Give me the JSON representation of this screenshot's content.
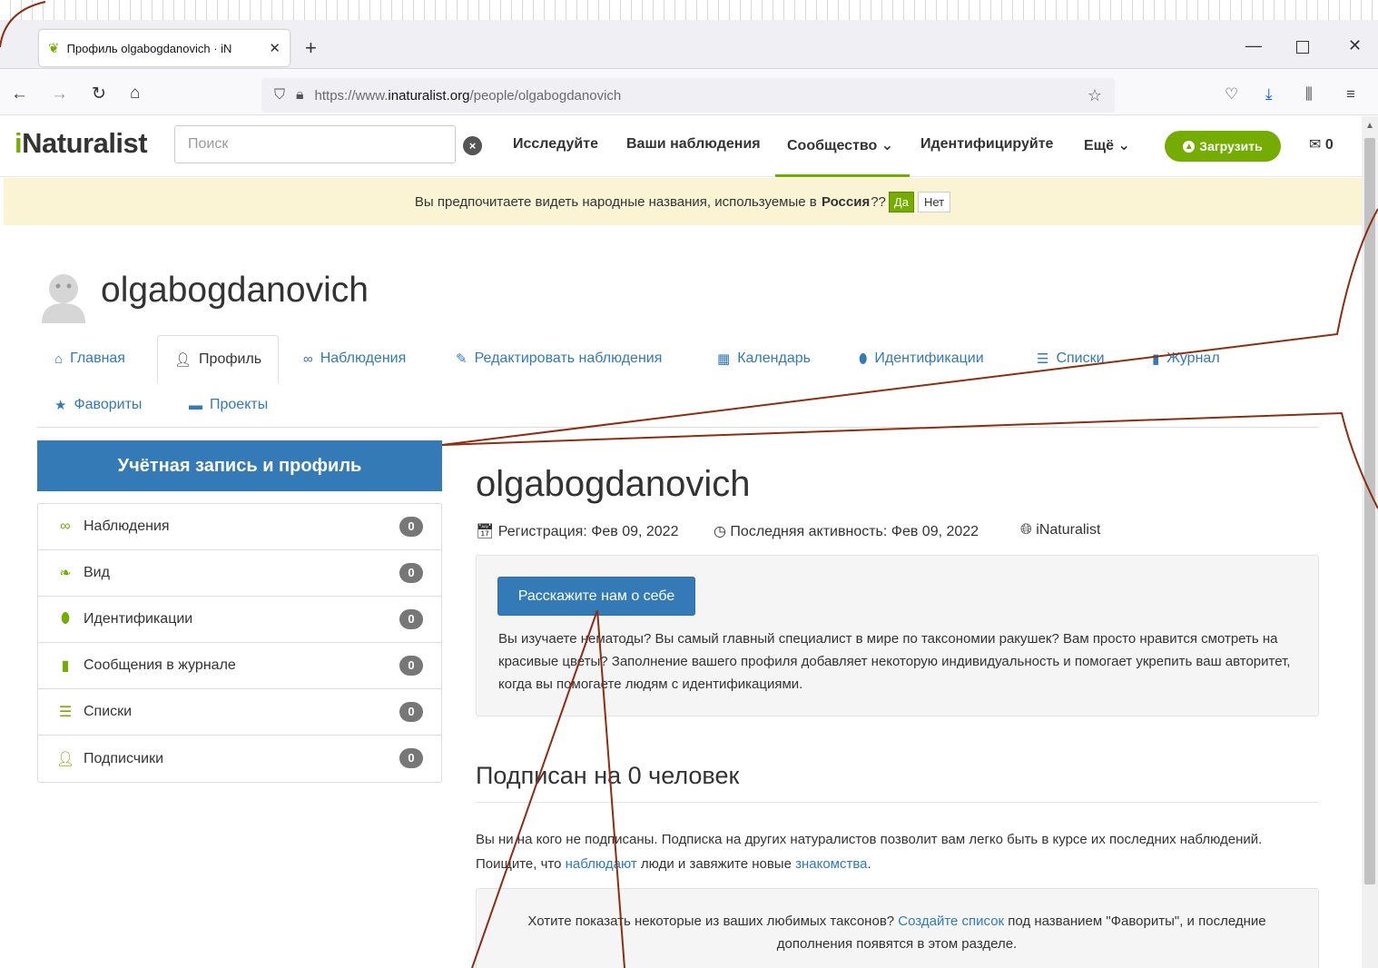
{
  "browser": {
    "tab_title": "Профиль olgabogdanovich · iN",
    "url_prefix": "https://www.",
    "url_host": "inaturalist.org",
    "url_path": "/people/olgabogdanovich"
  },
  "header": {
    "logo_i": "i",
    "logo_rest": "Naturalist",
    "search_placeholder": "Поиск",
    "nav": {
      "explore": "Исследуйте",
      "your_obs": "Ваши наблюдения",
      "community": "Сообщество",
      "identify": "Идентифицируйте",
      "more": "Ещё"
    },
    "upload": "Загрузить",
    "mail_count": "0"
  },
  "banner": {
    "text": "Вы предпочитаете видеть народные названия, используемые в",
    "place": "Россия",
    "q": "??",
    "yes": "Да",
    "no": "Нет"
  },
  "profile": {
    "username": "olgabogdanovich",
    "tabs": {
      "home": "Главная",
      "profile": "Профиль",
      "observations": "Наблюдения",
      "edit": "Редактировать наблюдения",
      "calendar": "Календарь",
      "ids": "Идентификации",
      "lists": "Списки",
      "journal": "Журнал",
      "favorites": "Фавориты",
      "projects": "Проекты"
    }
  },
  "sidebar": {
    "header": "Учётная запись и профиль",
    "items": [
      {
        "label": "Наблюдения",
        "count": "0"
      },
      {
        "label": "Вид",
        "count": "0"
      },
      {
        "label": "Идентификации",
        "count": "0"
      },
      {
        "label": "Сообщения в журнале",
        "count": "0"
      },
      {
        "label": "Списки",
        "count": "0"
      },
      {
        "label": "Подписчики",
        "count": "0"
      }
    ]
  },
  "main": {
    "title": "olgabogdanovich",
    "joined": "Регистрация: Фев 09, 2022",
    "last_active": "Последняя активность: Фев 09, 2022",
    "site": "iNaturalist",
    "about_button": "Расскажите нам о себе",
    "about_text": "Вы изучаете нематоды? Вы самый главный специалист в мире по таксономии ракушек? Вам просто нравится смотреть на красивые цветы? Заполнение вашего профиля добавляет некоторую индивидуальность и помогает укрепить ваш авторитет, когда вы помогаете людям с идентификациями.",
    "following_title": "Подписан на 0 человек",
    "following_p1": "Вы ни на кого не подписаны. Подписка на других натуралистов позволит вам легко быть в курсе их последних наблюдений. Поищите, что",
    "following_link1": "наблюдают",
    "following_p2": "люди и завяжите новые",
    "following_link2": "знакомства",
    "following_p3": ".",
    "fav_p1": "Хотите показать некоторые из ваших любимых таксонов?",
    "fav_link": "Создайте список",
    "fav_p2": "под названием \"Фавориты\", и последние дополнения появятся в этом разделе."
  },
  "colors": {
    "brand_green": "#74ac00",
    "primary_blue": "#337ab7",
    "annotation_brown": "#8b2e12"
  }
}
